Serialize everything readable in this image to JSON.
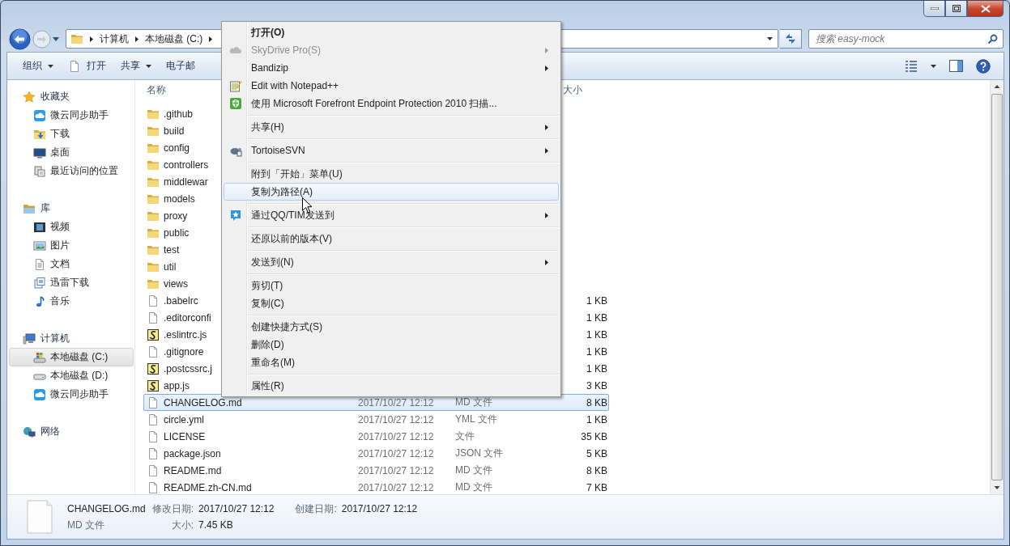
{
  "address_bar": {
    "segments": [
      "计算机",
      "本地磁盘 (C:)"
    ]
  },
  "search": {
    "placeholder": "搜索 easy-mock"
  },
  "toolbar": {
    "items": [
      {
        "label": "组织",
        "dropdown": true
      },
      {
        "label": "打开",
        "dropdown": false
      },
      {
        "label": "共享",
        "dropdown": true
      },
      {
        "label": "电子邮",
        "dropdown": false
      }
    ]
  },
  "sidebar": {
    "groups": [
      {
        "label": "收藏夹",
        "items": [
          {
            "label": "微云同步助手",
            "selected": false
          },
          {
            "label": "下载",
            "selected": false
          },
          {
            "label": "桌面",
            "selected": false
          },
          {
            "label": "最近访问的位置",
            "selected": false
          }
        ]
      },
      {
        "label": "库",
        "items": [
          {
            "label": "视频",
            "selected": false
          },
          {
            "label": "图片",
            "selected": false
          },
          {
            "label": "文档",
            "selected": false
          },
          {
            "label": "迅雷下载",
            "selected": false
          },
          {
            "label": "音乐",
            "selected": false
          }
        ]
      },
      {
        "label": "计算机",
        "items": [
          {
            "label": "本地磁盘 (C:)",
            "selected": true
          },
          {
            "label": "本地磁盘 (D:)",
            "selected": false
          },
          {
            "label": "微云同步助手",
            "selected": false
          }
        ]
      },
      {
        "label": "网络"
      }
    ]
  },
  "file_list": {
    "columns": [
      {
        "label": "名称"
      },
      {
        "label": "大小"
      }
    ],
    "rows": [
      {
        "name": ".github",
        "kind": "folder",
        "selected": false
      },
      {
        "name": "build",
        "kind": "folder",
        "selected": false
      },
      {
        "name": "config",
        "kind": "folder",
        "selected": false
      },
      {
        "name": "controllers",
        "kind": "folder",
        "selected": false
      },
      {
        "name": "middlewar",
        "kind": "folder",
        "selected": false
      },
      {
        "name": "models",
        "kind": "folder",
        "selected": false
      },
      {
        "name": "proxy",
        "kind": "folder",
        "selected": false
      },
      {
        "name": "public",
        "kind": "folder",
        "selected": false
      },
      {
        "name": "test",
        "kind": "folder",
        "selected": false
      },
      {
        "name": "util",
        "kind": "folder",
        "selected": false
      },
      {
        "name": "views",
        "kind": "folder",
        "selected": false
      },
      {
        "name": ".babelrc",
        "kind": "file",
        "size": "1 KB",
        "selected": false
      },
      {
        "name": ".editorconfi",
        "kind": "file",
        "size": "1 KB",
        "selected": false
      },
      {
        "name": ".eslintrc.js",
        "kind": "script",
        "size": "1 KB",
        "selected": false
      },
      {
        "name": ".gitignore",
        "kind": "file",
        "size": "1 KB",
        "selected": false
      },
      {
        "name": ".postcssrc.j",
        "kind": "script",
        "size": "1 KB",
        "selected": false
      },
      {
        "name": "app.js",
        "kind": "script",
        "size": "3 KB",
        "selected": false
      },
      {
        "name": "CHANGELOG.md",
        "kind": "file",
        "date": "2017/10/27 12:12",
        "type": "MD 文件",
        "size": "8 KB",
        "selected": true
      },
      {
        "name": "circle.yml",
        "kind": "file",
        "date": "2017/10/27 12:12",
        "type": "YML 文件",
        "size": "1 KB",
        "selected": false
      },
      {
        "name": "LICENSE",
        "kind": "file",
        "date": "2017/10/27 12:12",
        "type": "文件",
        "size": "35 KB",
        "selected": false
      },
      {
        "name": "package.json",
        "kind": "file",
        "date": "2017/10/27 12:12",
        "type": "JSON 文件",
        "size": "5 KB",
        "selected": false
      },
      {
        "name": "README.md",
        "kind": "file",
        "date": "2017/10/27 12:12",
        "type": "MD 文件",
        "size": "8 KB",
        "selected": false
      },
      {
        "name": "README.zh-CN.md",
        "kind": "file",
        "date": "2017/10/27 12:12",
        "type": "MD 文件",
        "size": "7 KB",
        "selected": false
      }
    ]
  },
  "details": {
    "name": "CHANGELOG.md",
    "type": "MD 文件",
    "modified_label": "修改日期:",
    "modified": "2017/10/27 12:12",
    "created_label": "创建日期:",
    "created": "2017/10/27 12:12",
    "size_label": "大小:",
    "size": "7.45 KB"
  },
  "context_menu": {
    "items": [
      {
        "kind": "item",
        "label": "打开(O)",
        "default": true,
        "disabled": false,
        "submenu": false,
        "selected": false
      },
      {
        "kind": "item",
        "label": "SkyDrive Pro(S)",
        "default": false,
        "disabled": true,
        "submenu": true,
        "selected": false
      },
      {
        "kind": "item",
        "label": "Bandizip",
        "default": false,
        "disabled": false,
        "submenu": true,
        "selected": false
      },
      {
        "kind": "item",
        "label": "Edit with Notepad++",
        "default": false,
        "disabled": false,
        "submenu": false,
        "selected": false
      },
      {
        "kind": "item",
        "label": "使用 Microsoft Forefront Endpoint Protection 2010 扫描...",
        "default": false,
        "disabled": false,
        "submenu": false,
        "selected": false
      },
      {
        "kind": "separator"
      },
      {
        "kind": "item",
        "label": "共享(H)",
        "default": false,
        "disabled": false,
        "submenu": true,
        "selected": false
      },
      {
        "kind": "separator"
      },
      {
        "kind": "item",
        "label": "TortoiseSVN",
        "default": false,
        "disabled": false,
        "submenu": true,
        "selected": false
      },
      {
        "kind": "separator"
      },
      {
        "kind": "item",
        "label": "附到「开始」菜单(U)",
        "default": false,
        "disabled": false,
        "submenu": false,
        "selected": false
      },
      {
        "kind": "item",
        "label": "复制为路径(A)",
        "default": false,
        "disabled": false,
        "submenu": false,
        "selected": true
      },
      {
        "kind": "separator"
      },
      {
        "kind": "item",
        "label": "通过QQ/TIM发送到",
        "default": false,
        "disabled": false,
        "submenu": true,
        "selected": false
      },
      {
        "kind": "separator"
      },
      {
        "kind": "item",
        "label": "还原以前的版本(V)",
        "default": false,
        "disabled": false,
        "submenu": false,
        "selected": false
      },
      {
        "kind": "separator"
      },
      {
        "kind": "item",
        "label": "发送到(N)",
        "default": false,
        "disabled": false,
        "submenu": true,
        "selected": false
      },
      {
        "kind": "separator"
      },
      {
        "kind": "item",
        "label": "剪切(T)",
        "default": false,
        "disabled": false,
        "submenu": false,
        "selected": false
      },
      {
        "kind": "item",
        "label": "复制(C)",
        "default": false,
        "disabled": false,
        "submenu": false,
        "selected": false
      },
      {
        "kind": "separator"
      },
      {
        "kind": "item",
        "label": "创建快捷方式(S)",
        "default": false,
        "disabled": false,
        "submenu": false,
        "selected": false
      },
      {
        "kind": "item",
        "label": "删除(D)",
        "default": false,
        "disabled": false,
        "submenu": false,
        "selected": false
      },
      {
        "kind": "item",
        "label": "重命名(M)",
        "default": false,
        "disabled": false,
        "submenu": false,
        "selected": false
      },
      {
        "kind": "separator"
      },
      {
        "kind": "item",
        "label": "属性(R)",
        "default": false,
        "disabled": false,
        "submenu": false,
        "selected": false
      }
    ]
  }
}
